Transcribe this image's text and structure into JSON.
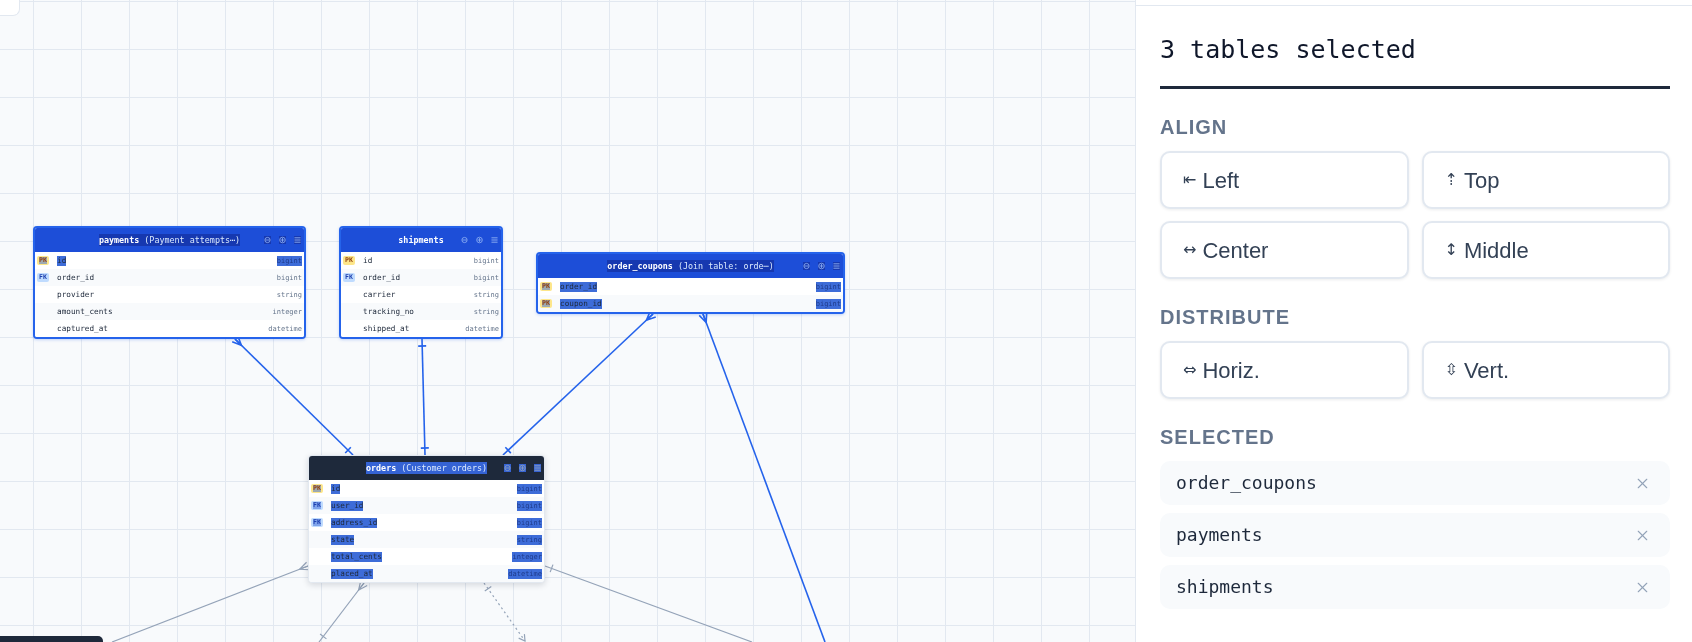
{
  "canvas": {
    "tables": [
      {
        "name": "payments",
        "comment": "(Payment attempts⋯)",
        "selected": true,
        "title_highlighted": true,
        "columns": [
          {
            "key": {
              "text": "PK",
              "kind": "primary"
            },
            "name": "id",
            "data_type": "bigint",
            "highlighted": true
          },
          {
            "key": {
              "text": "FK",
              "kind": "foreign"
            },
            "name": "order_id",
            "data_type": "bigint",
            "highlighted": false
          },
          {
            "name": "provider",
            "data_type": "string",
            "highlighted": false
          },
          {
            "name": "amount_cents",
            "data_type": "integer",
            "highlighted": false
          },
          {
            "name": "captured_at",
            "data_type": "datetime",
            "highlighted": false
          }
        ]
      },
      {
        "name": "shipments",
        "selected": true,
        "title_highlighted": false,
        "columns": [
          {
            "key": {
              "text": "PK",
              "kind": "primary"
            },
            "name": "id",
            "data_type": "bigint",
            "highlighted": false
          },
          {
            "key": {
              "text": "FK",
              "kind": "foreign"
            },
            "name": "order_id",
            "data_type": "bigint",
            "highlighted": false
          },
          {
            "name": "carrier",
            "data_type": "string",
            "highlighted": false
          },
          {
            "name": "tracking_no",
            "data_type": "string",
            "highlighted": false
          },
          {
            "name": "shipped_at",
            "data_type": "datetime",
            "highlighted": false
          }
        ]
      },
      {
        "name": "order_coupons",
        "comment": "(Join table: orde⋯)",
        "selected": true,
        "title_highlighted": true,
        "columns": [
          {
            "key": {
              "text": "PK",
              "kind": "primary"
            },
            "name": "order_id",
            "data_type": "bigint",
            "highlighted": true
          },
          {
            "key": {
              "text": "PK",
              "kind": "primary"
            },
            "name": "coupon_id",
            "data_type": "bigint",
            "highlighted": true
          }
        ]
      },
      {
        "name": "orders",
        "comment": "(Customer orders)",
        "selected": false,
        "title_highlighted": true,
        "columns": [
          {
            "key": {
              "text": "PK",
              "kind": "primary"
            },
            "name": "id",
            "data_type": "bigint",
            "highlighted": true
          },
          {
            "key": {
              "text": "FK",
              "kind": "foreign"
            },
            "name": "user_id",
            "data_type": "bigint",
            "highlighted": true
          },
          {
            "key": {
              "text": "FK",
              "kind": "foreign"
            },
            "name": "address_id",
            "data_type": "bigint",
            "highlighted": true
          },
          {
            "name": "state",
            "data_type": "string",
            "highlighted": true
          },
          {
            "name": "total_cents",
            "data_type": "integer",
            "highlighted": true
          },
          {
            "name": "placed_at",
            "data_type": "datetime",
            "highlighted": true
          }
        ]
      }
    ],
    "relations": [
      {
        "selected": true,
        "kind": "solid"
      },
      {
        "selected": true,
        "kind": "solid"
      },
      {
        "selected": true,
        "kind": "solid"
      },
      {
        "selected": true,
        "kind": "solid"
      },
      {
        "selected": false,
        "kind": "solid"
      },
      {
        "selected": false,
        "kind": "solid"
      },
      {
        "selected": false,
        "kind": "dotted"
      },
      {
        "selected": false,
        "kind": "solid"
      }
    ]
  },
  "sidebar": {
    "title": "3 tables selected",
    "sections": [
      {
        "label": "ALIGN",
        "buttons": [
          {
            "icon": "⇤",
            "label": "Left"
          },
          {
            "icon": "⇡",
            "label": "Top"
          },
          {
            "icon": "↔",
            "label": "Center"
          },
          {
            "icon": "↕",
            "label": "Middle"
          }
        ]
      },
      {
        "label": "DISTRIBUTE",
        "buttons": [
          {
            "icon": "⇔",
            "label": "Horiz."
          },
          {
            "icon": "⇳",
            "label": "Vert."
          }
        ]
      }
    ],
    "selected_list": {
      "label": "SELECTED",
      "items": [
        {
          "name": "order_coupons"
        },
        {
          "name": "payments"
        },
        {
          "name": "shipments"
        }
      ]
    }
  }
}
